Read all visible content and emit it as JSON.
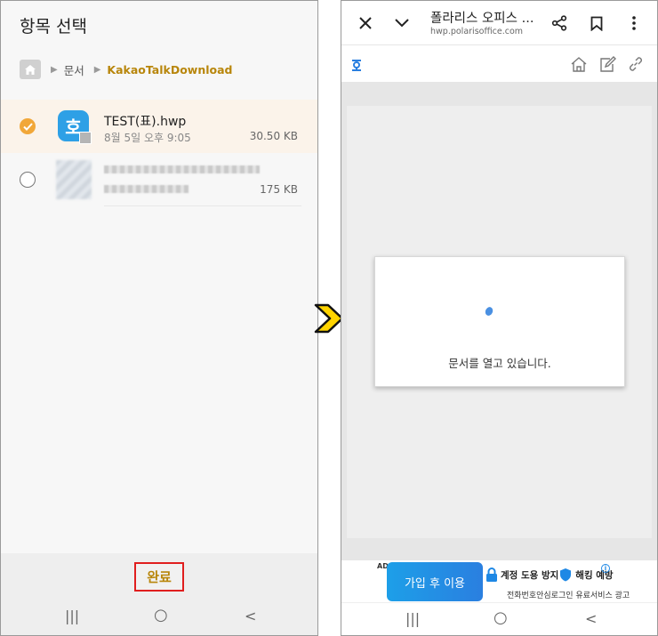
{
  "left": {
    "title": "항목 선택",
    "breadcrumb": {
      "home_icon": "home-icon",
      "folder": "문서",
      "current": "KakaoTalkDownload"
    },
    "files": [
      {
        "name": "TEST(표).hwp",
        "meta": "8월 5일 오후 9:05",
        "size": "30.50 KB",
        "selected": true,
        "icon_text": "호"
      },
      {
        "name": "",
        "meta": "",
        "size": "175 KB",
        "selected": false
      }
    ],
    "done_label": "완료",
    "nav": {
      "recents": "|||",
      "home": "○",
      "back": "<"
    }
  },
  "right": {
    "title": "폴라리스 오피스 ...",
    "url": "hwp.polarisoffice.com",
    "loading_text": "문서를 열고 있습니다.",
    "ad": {
      "label": "AD",
      "button": "가입 후 이용",
      "headline_1": "계정 도용 방지",
      "headline_2": "해킹 예방",
      "sub": "전화번호안심로그인 유료서비스 광고",
      "info": "i"
    },
    "nav": {
      "recents": "|||",
      "home": "○",
      "back": "<"
    }
  },
  "colors": {
    "accent_orange": "#f1a739",
    "folder_gold": "#b8860b",
    "highlight_red": "#e01e1e",
    "arrow_yellow": "#ffd400"
  }
}
